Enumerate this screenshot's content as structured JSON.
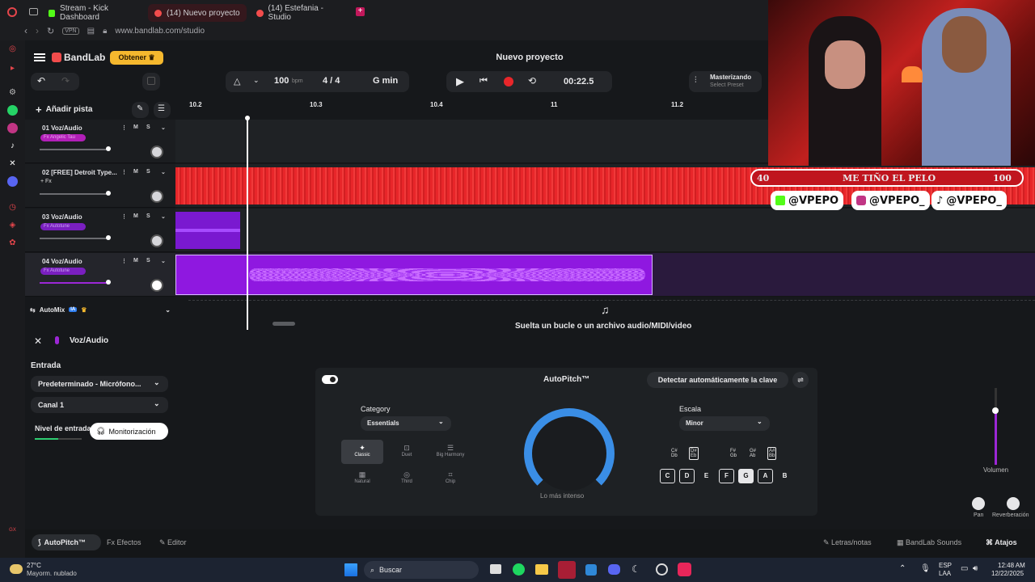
{
  "browser": {
    "tabs": [
      {
        "label": "Stream - Kick Dashboard",
        "color": "#53fc18"
      },
      {
        "label": "(14) Nuevo proyecto",
        "color": "#f24c4c"
      },
      {
        "label": "(14) Estefania - Studio",
        "color": "#f24c4c"
      }
    ],
    "vpn": "VPN",
    "url": "www.bandlab.com/studio"
  },
  "app": {
    "brand": "BandLab",
    "obtener": "Obtener",
    "project_title": "Nuevo proyecto",
    "tempo": "100",
    "tempo_unit": "bpm",
    "time_sig": "4 / 4",
    "key": "G min",
    "time": "00:22.5",
    "mastering_title": "Masterizando",
    "mastering_sub": "Select Preset",
    "add_track": "Añadir pista",
    "ruler": [
      "10.2",
      "10.3",
      "10.4",
      "11",
      "11.2"
    ],
    "tracks": [
      {
        "name": "01  Voz/Audio",
        "fx": "Fx Angelic Tau",
        "color": "#b21fb8"
      },
      {
        "name": "02  [FREE] Detroit Type...",
        "fx": "+ Fx",
        "color": "#e8262a"
      },
      {
        "name": "03  Voz/Audio",
        "fx": "Fx Autotune",
        "color": "#8a1fc8"
      },
      {
        "name": "04  Voz/Audio",
        "fx": "Fx Autotune",
        "color": "#8a1fc8"
      }
    ],
    "m": "M",
    "s": "S",
    "automix": "AutoMix",
    "automix_badge": "IA",
    "drop_text": "Suelta un bucle o un archivo audio/MIDI/video"
  },
  "overlay": {
    "left_num": "40",
    "title": "ME TIÑO EL PELO",
    "right_num": "100",
    "handles": [
      "@VPEPO",
      "@VPEPO_",
      "@VPEPO_"
    ]
  },
  "panel": {
    "title": "Voz/Audio",
    "entrada": "Entrada",
    "input_device": "Predeterminado - Micrófono...",
    "channel": "Canal 1",
    "level_label": "Nivel de entrada",
    "monitor": "Monitorización",
    "autopitch": "AutoPitch™",
    "detect": "Detectar automáticamente la clave",
    "category_label": "Category",
    "category_value": "Essentials",
    "categories": [
      "Classic",
      "Duet",
      "Big Harmony",
      "Natural",
      "Third",
      "Chip"
    ],
    "intensity": "Lo más intenso",
    "scale_label": "Escala",
    "scale_value": "Minor",
    "sharp_keys": [
      "C#\nDb",
      "D#\nEb",
      "F#\nGb",
      "G#\nAb",
      "A#\nBb"
    ],
    "keys": [
      "C",
      "D",
      "E",
      "F",
      "G",
      "A",
      "B"
    ],
    "volume": "Volumen",
    "pan": "Pan",
    "reverb": "Reverberación"
  },
  "footer": {
    "tabs": [
      "AutoPitch™",
      "Efectos",
      "Editor"
    ],
    "right": [
      "Letras/notas",
      "BandLab Sounds",
      "Atajos"
    ]
  },
  "taskbar": {
    "weather_temp": "27°C",
    "weather_desc": "Mayorm. nublado",
    "search": "Buscar",
    "lang1": "ESP",
    "lang2": "LAA",
    "time": "12:48 AM",
    "date": "12/22/2025"
  }
}
